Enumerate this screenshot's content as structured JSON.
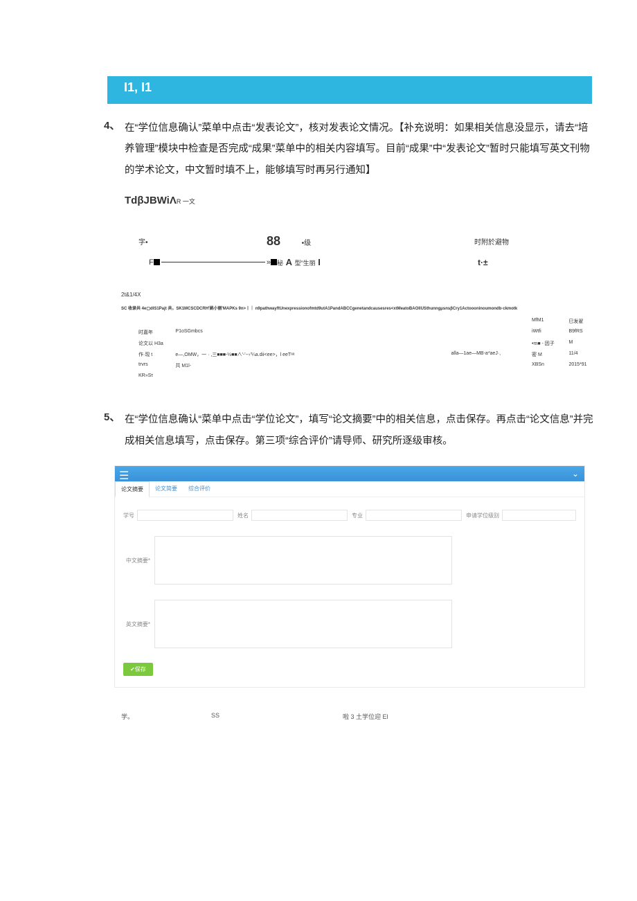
{
  "banner": "I1, I1",
  "section4": {
    "num": "4、",
    "text": "在“学位信息确认”菜单中点击“发表论文”，核对发表论文情况。【补充说明：如果相关信息没显示，请去“培养管理”模块中检查是否完成“成果”菜单中的相关内容填写。目前“成果”中“发表论文”暂时只能填写英文刊物的学术论文，中文暂时填不上，能够填写时再另行通知】"
  },
  "ocr1": {
    "main": "TdβJBWiΛ",
    "sub": "R 一文"
  },
  "row1": {
    "c1": "字•",
    "big": "88",
    "c2": "•级",
    "c3": "时附於避物"
  },
  "row2": {
    "left_prefix": "F",
    "mid": "秘",
    "mid_bold": "A",
    "mid_after": " 型”生丽",
    "mid_end": "I",
    "right": "t·±"
  },
  "tiny_code": "2t&1/4X",
  "tiny_line": "SC 收录共 4e▢dlS1Pajt 共，SK1MCSCDCRH'姚小丽'MAPKs 9n>丨｜ n9pathwayftUnexpressionofmtd9utA1PandABCCgenetandcausesres<xtMeatoBAOllUSthunngμsnsβCry1Actoooninoumondb·ckmotk",
  "table": {
    "h4": "MfM1",
    "h5": "巳发翟",
    "r1": {
      "c1": "时嘉年",
      "c2": "P1oSGmbcs",
      "c4": "iWtfi",
      "c5": "B9fRS"
    },
    "r2": {
      "c1": "论文以 H3a",
      "c4": "•m■ - 因子",
      "c5": "M"
    },
    "r3": {
      "c1": "作·现 t",
      "c2": "e—,OMW，一 · ,三■■■-½■■∧'-'--›'¼a.dii<ee>，l  eeTᵃᵃ",
      "c3": "alla—1ae—MB-a*aeJ·,",
      "c4": "密 M",
      "c5": "11/4"
    },
    "r4": {
      "c1": "trvrs",
      "c2": "共 M1l-",
      "c4": "XBSn",
      "c5": "2015*91"
    },
    "r5": {
      "c1": "KR»Sτ"
    }
  },
  "section5": {
    "num": "5、",
    "text": "在“学位信息确认“菜单中点击“学位论文”，填写“论文摘要”中的相关信息，点击保存。再点击“论文信息”并完成相关信息填写，点击保存。第三项“综合评价”请导师、研究所逐级审核。"
  },
  "form": {
    "tabs": {
      "t1": "论文摘要",
      "t2": "论文简要",
      "t3": "综合评价"
    },
    "fields": {
      "f1": "学号",
      "f2": "姓名",
      "f3": "专业",
      "f4": "申请学位级别"
    },
    "cn_abs": "中文摘要*",
    "en_abs": "英文摘要*",
    "save": "✔保存"
  },
  "bottom": {
    "c1": "学。",
    "c2": "SS",
    "c3": "啦                            3 土学位迎 El"
  }
}
